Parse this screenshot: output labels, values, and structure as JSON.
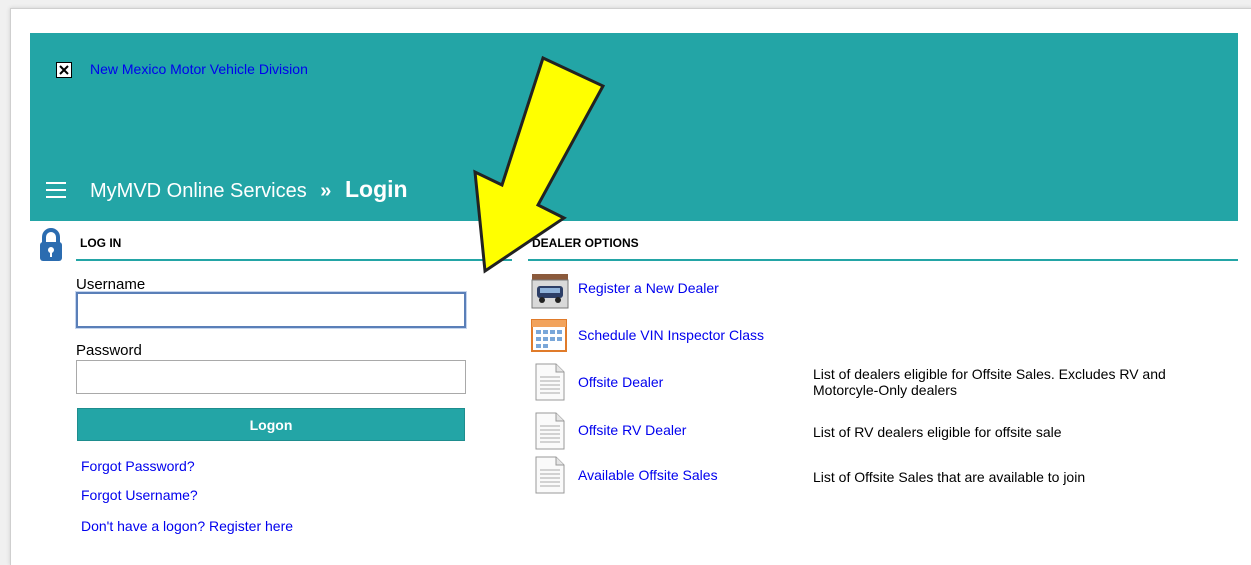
{
  "header": {
    "site_link": "New Mexico Motor Vehicle Division",
    "breadcrumb_parent": "MyMVD Online Services",
    "breadcrumb_sep": "»",
    "breadcrumb_current": "Login"
  },
  "login": {
    "title": "LOG IN",
    "username_label": "Username",
    "username_value": "",
    "password_label": "Password",
    "password_value": "",
    "logon_button": "Logon",
    "links": [
      "Forgot Password?",
      "Forgot Username?",
      "Don't have a logon? Register here"
    ]
  },
  "dealer": {
    "title": "DEALER OPTIONS",
    "items": [
      {
        "label": "Register a New Dealer",
        "icon": "car-icon",
        "desc": ""
      },
      {
        "label": "Schedule VIN Inspector Class",
        "icon": "calendar-icon",
        "desc": ""
      },
      {
        "label": "Offsite Dealer",
        "icon": "document-icon",
        "desc": "List of dealers eligible for Offsite Sales. Excludes RV and Motorcyle-Only dealers"
      },
      {
        "label": "Offsite RV Dealer",
        "icon": "document-icon",
        "desc": "List of RV dealers eligible for offsite sale"
      },
      {
        "label": "Available Offsite Sales",
        "icon": "document-icon",
        "desc": "List of Offsite Sales that are available to join"
      }
    ]
  },
  "colors": {
    "teal": "#23a5a6",
    "link": "#0000ee",
    "arrow": "#ffff00"
  }
}
